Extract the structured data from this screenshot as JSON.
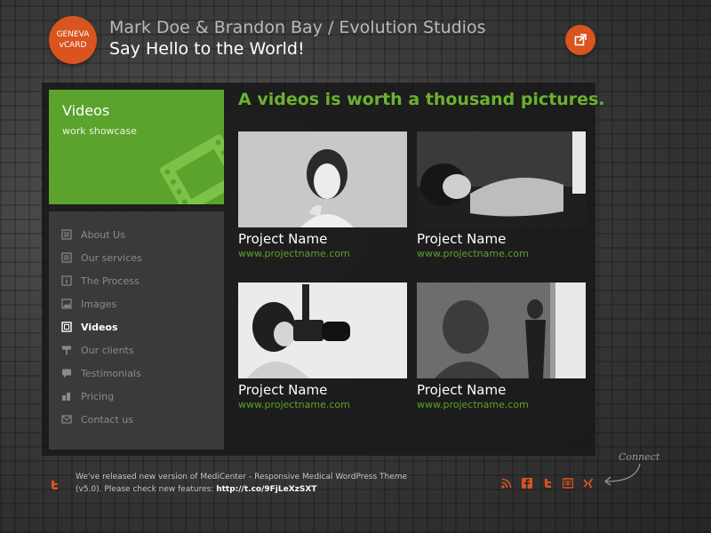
{
  "brand": {
    "logo_line1": "GENEVA",
    "logo_line2": "vCARD",
    "subtitle": "Mark Doe & Brandon Bay / Evolution Studios",
    "title": "Say Hello to the World!"
  },
  "header": {
    "external_icon": "external-link-icon"
  },
  "sidebar": {
    "section_title": "Videos",
    "section_subtitle": "work showcase",
    "items": [
      {
        "label": "About Us",
        "icon": "document-icon",
        "active": false
      },
      {
        "label": "Our services",
        "icon": "list-icon",
        "active": false
      },
      {
        "label": "The Process",
        "icon": "info-icon",
        "active": false
      },
      {
        "label": "Images",
        "icon": "image-icon",
        "active": false
      },
      {
        "label": "Videos",
        "icon": "film-icon",
        "active": true
      },
      {
        "label": "Our clients",
        "icon": "sign-icon",
        "active": false
      },
      {
        "label": "Testimonials",
        "icon": "chat-icon",
        "active": false
      },
      {
        "label": "Pricing",
        "icon": "coins-icon",
        "active": false
      },
      {
        "label": "Contact us",
        "icon": "mail-icon",
        "active": false
      }
    ]
  },
  "main": {
    "heading": "A videos is worth a thousand pictures.",
    "projects": [
      {
        "name": "Project Name",
        "url": "www.projectname.com"
      },
      {
        "name": "Project Name",
        "url": "www.projectname.com"
      },
      {
        "name": "Project Name",
        "url": "www.projectname.com"
      },
      {
        "name": "Project Name",
        "url": "www.projectname.com"
      }
    ]
  },
  "footer": {
    "news_text": "We've released new version of MediCenter - Responsive Medical WordPress Theme (v5.0). Please check new features:",
    "news_link": "http://t.co/9FjLeXzSXT",
    "connect_label": "Connect",
    "social_icons": [
      "rss-icon",
      "facebook-icon",
      "twitter-icon",
      "youtube-icon",
      "xing-icon"
    ]
  },
  "colors": {
    "accent_orange": "#d9541e",
    "accent_green": "#5ba32c",
    "heading_green": "#6ab22f"
  }
}
